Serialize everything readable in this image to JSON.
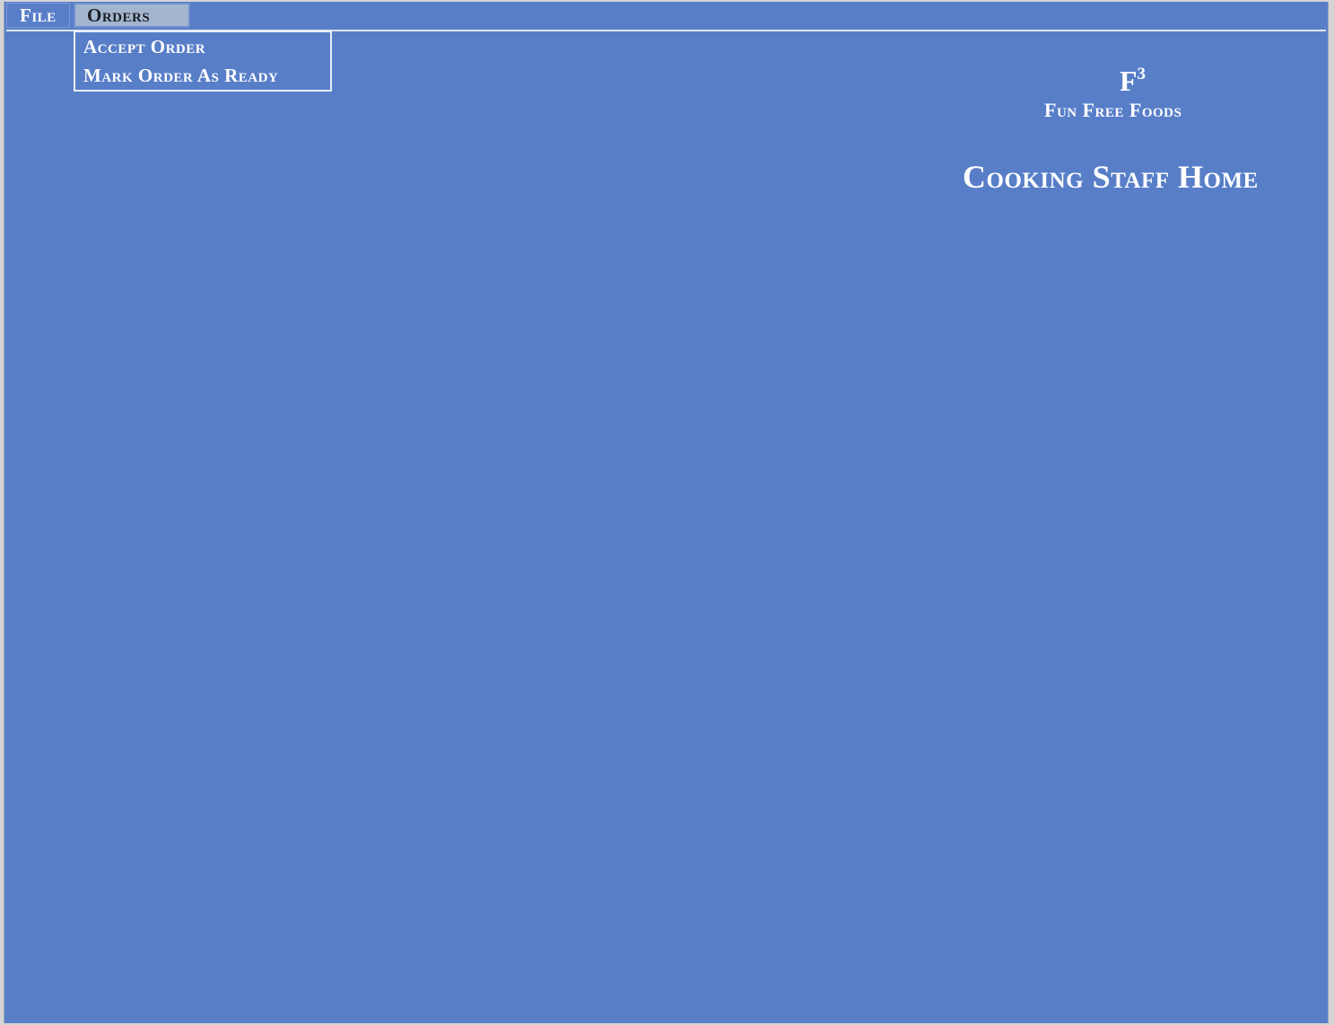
{
  "menubar": {
    "file_label": "File",
    "orders_label": "Orders"
  },
  "orders_menu": {
    "items": [
      {
        "label": "Accept Order"
      },
      {
        "label": "Mark Order As Ready"
      }
    ]
  },
  "brand": {
    "logo_letter": "F",
    "logo_exponent": "3",
    "name": "Fun Free Foods"
  },
  "page": {
    "title": "Cooking Staff Home"
  },
  "colors": {
    "background": "#587ec8",
    "active_menu": "#a4b6cf",
    "text": "#ffffff"
  }
}
